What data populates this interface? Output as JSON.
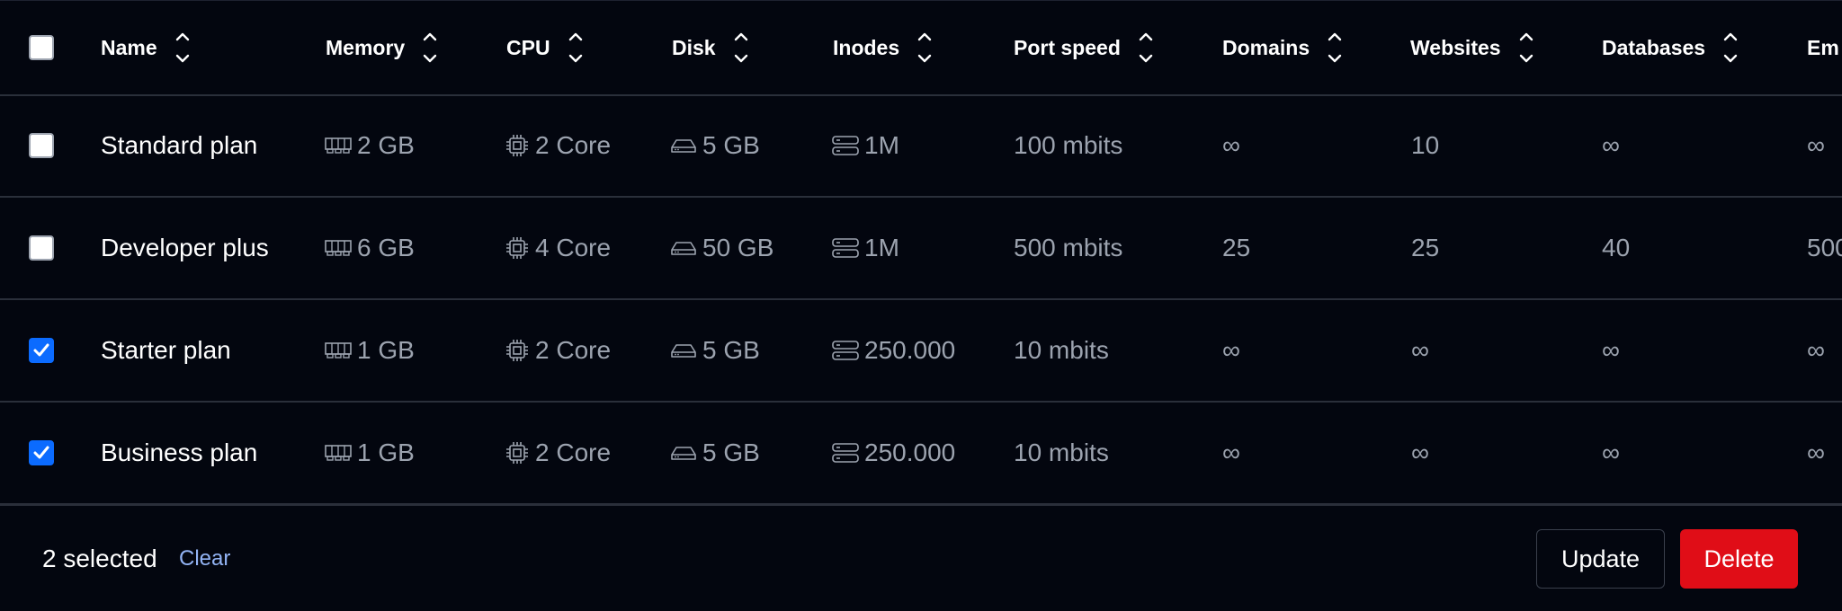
{
  "columns": {
    "name": "Name",
    "memory": "Memory",
    "cpu": "CPU",
    "disk": "Disk",
    "inodes": "Inodes",
    "port_speed": "Port speed",
    "domains": "Domains",
    "websites": "Websites",
    "databases": "Databases",
    "emails": "Em"
  },
  "rows": [
    {
      "checked": false,
      "name": "Standard plan",
      "memory": "2 GB",
      "cpu": "2 Core",
      "disk": "5 GB",
      "inodes": "1M",
      "port_speed": "100 mbits",
      "domains": "∞",
      "websites": "10",
      "databases": "∞",
      "emails": "∞"
    },
    {
      "checked": false,
      "name": "Developer plus",
      "memory": "6 GB",
      "cpu": "4 Core",
      "disk": "50 GB",
      "inodes": "1M",
      "port_speed": "500 mbits",
      "domains": "25",
      "websites": "25",
      "databases": "40",
      "emails": "500"
    },
    {
      "checked": true,
      "name": "Starter plan",
      "memory": "1 GB",
      "cpu": "2 Core",
      "disk": "5 GB",
      "inodes": "250.000",
      "port_speed": "10 mbits",
      "domains": "∞",
      "websites": "∞",
      "databases": "∞",
      "emails": "∞"
    },
    {
      "checked": true,
      "name": "Business plan",
      "memory": "1 GB",
      "cpu": "2 Core",
      "disk": "5 GB",
      "inodes": "250.000",
      "port_speed": "10 mbits",
      "domains": "∞",
      "websites": "∞",
      "databases": "∞",
      "emails": "∞"
    }
  ],
  "footer": {
    "selected_text": "2 selected",
    "clear_label": "Clear",
    "update_label": "Update",
    "delete_label": "Delete"
  },
  "colors": {
    "background": "#03060f",
    "checkbox_checked": "#0b6bff",
    "delete_button": "#e00d17",
    "link": "#93b4f5",
    "muted_text": "#9ca3af"
  },
  "icons": {
    "memory": "memory-icon",
    "cpu": "cpu-icon",
    "disk": "disk-icon",
    "inodes": "server-icon",
    "sort": "sort-icon"
  }
}
